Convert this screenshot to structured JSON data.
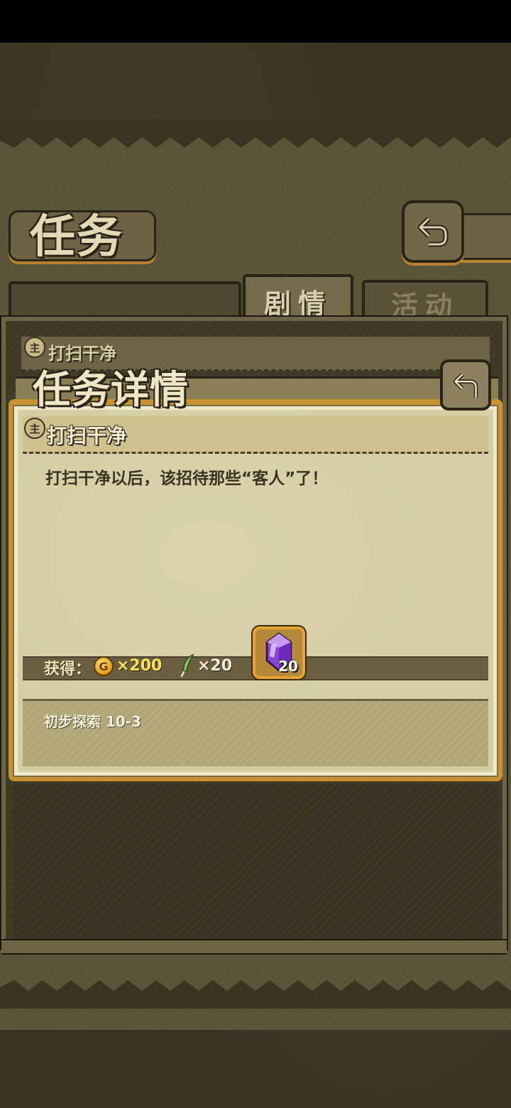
{
  "screen": {
    "title": "任务",
    "tabs": [
      {
        "label": "剧情",
        "active": true
      },
      {
        "label": "活动",
        "active": false
      }
    ]
  },
  "quest_list": {
    "items": [
      {
        "badge": "主",
        "name": "打扫干净"
      }
    ]
  },
  "detail": {
    "title": "任务详情",
    "quest_badge": "主",
    "quest_name": "打扫干净",
    "description": "打扫干净以后，该招待那些“客人”了！",
    "rewards_label": "获得：",
    "rewards": {
      "coin_icon_letter": "G",
      "coin_amount": "×200",
      "feather_amount": "×20",
      "gem_count": "20"
    },
    "requirement": "初步探索 10-3"
  },
  "icons": {
    "back": "back-arrow-icon",
    "coin": "gold-coin-icon",
    "feather": "feather-icon",
    "gem": "purple-gem-icon"
  },
  "colors": {
    "accent_gold": "#e6a431",
    "coin_text": "#ffe05a",
    "parchment": "#d6cfa5"
  }
}
